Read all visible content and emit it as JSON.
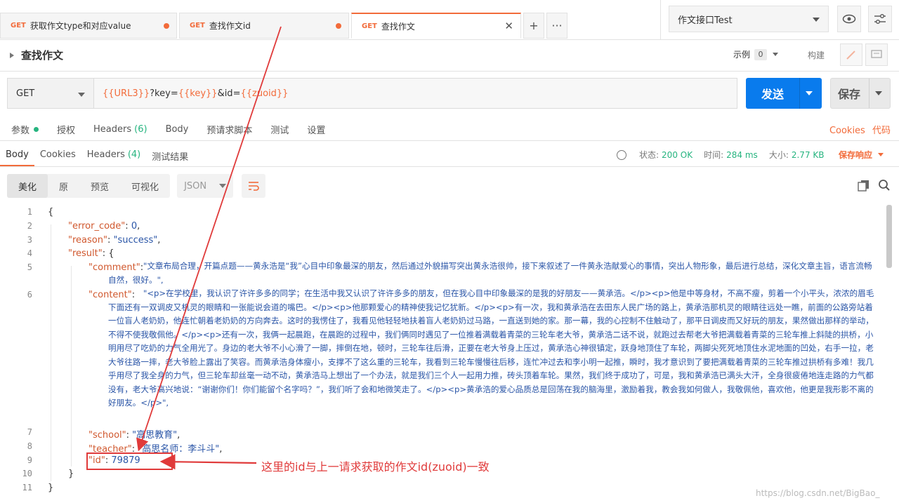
{
  "tabs": [
    {
      "method": "GET",
      "title": "获取作文type和对应value",
      "dirty": true
    },
    {
      "method": "GET",
      "title": "查找作文id",
      "dirty": true
    },
    {
      "method": "GET",
      "title": "查找作文",
      "active": true
    }
  ],
  "env": {
    "name": "作文接口Test"
  },
  "request": {
    "name": "查找作文",
    "examples_label": "示例",
    "examples_count": "0",
    "build_label": "构建",
    "method": "GET",
    "url": {
      "v1": "{{URL3}}",
      "t1": "?key=",
      "v2": "{{key}}",
      "t2": "&id=",
      "v3": "{{zuoid}}"
    },
    "send": "发送",
    "save": "保存"
  },
  "req_tabs": {
    "params": "参数",
    "auth": "授权",
    "headers": "Headers",
    "headers_count": "(6)",
    "body": "Body",
    "prereq": "预请求脚本",
    "tests": "测试",
    "settings": "设置",
    "cookies": "Cookies",
    "code": "代码"
  },
  "resp_tabs": {
    "body": "Body",
    "cookies": "Cookies",
    "headers": "Headers",
    "headers_count": "(4)",
    "results": "测试结果"
  },
  "status": {
    "status_label": "状态:",
    "status_val": "200 OK",
    "time_label": "时间:",
    "time_val": "284 ms",
    "size_label": "大小:",
    "size_val": "2.77 KB",
    "save_resp": "保存响应"
  },
  "format": {
    "pretty": "美化",
    "raw": "原",
    "preview": "预览",
    "visualize": "可视化",
    "lang": "JSON"
  },
  "code": {
    "l1": "{",
    "k_error": "\"error_code\"",
    "v_error": "0",
    "k_reason": "\"reason\"",
    "v_reason": "\"success\"",
    "k_result": "\"result\"",
    "k_comment": "\"comment\"",
    "v_comment": "\"文章布局合理，开篇点题——黄永浩是“我”心目中印象最深的朋友，然后通过外貌描写突出黄永浩很帅，接下来叙述了一件黄永浩献爱心的事情，突出人物形象，最后进行总结，深化文章主旨，语言流畅自然，很好。\",",
    "k_content": "\"content\"",
    "v_content": "\"<p>在学校里，我认识了许许多多的同学；在生活中我又认识了许许多多的朋友，但在我心目中印象最深的是我的好朋友——黄承浩。</p><p>他是中等身材，不高不瘦，剪着一个小平头，浓浓的眉毛下面还有一双调皮又机灵的眼睛和一张能说会道的嘴巴。</p><p>他那颗爱心的精神使我记忆犹新。</p><p>有一次，我和黄承浩在去田东人民广场的路上，黄承浩那机灵的眼睛往远处一瞧，前面的公路旁站着一位盲人老奶奶，他连忙朝着老奶奶的方向奔去。这时的我愣住了，我看见他轻轻地扶着盲人老奶奶过马路，一直送到她的家。那一幕，我的心控制不住触动了，那平日调皮而又好玩的朋友，果然做出那样的举动，不得不使我敬佩他。</p><p>还有一次，我俩一起晨跑，在晨跑的过程中，我们俩同时遇见了一位推着满载着青菜的三轮车老大爷，黄承浩二话不说，就跑过去帮老大爷把满载着青菜的三轮车推上斜陡的拱桥，小明用尽了吃奶的力气全用光了。身边的老大爷不小心滑了一脚，摔倒在地，顿时，三轮车往后滑，正要在老大爷身上压过，黄承浩心神很镇定，跃身地顶住了车轮，两脚尖死死地顶住水泥地面的凹处，右手一拉，老大爷往路一摔，老大爷脸上露出了笑容。而黄承浩身体瘦小，支撑不了这么重的三轮车，我看到三轮车慢慢往后移，连忙冲过去和李小明一起推，瞬时，我才意识到了要把满载着青菜的三轮车推过拱桥有多难！我几乎用尽了我全身的力气，但三轮车却丝毫一动不动，黄承浩马上想出了一个办法，就是我们三个人一起用力推，砖头顶着车轮。果然，我们终于成功了，可是，我和黄承浩已满头大汗，全身很疲倦地连走路的力气都没有，老大爷高兴地说：“谢谢你们！你们能留个名字吗？”，我们听了会和地微笑走了。</p><p>黄承浩的爱心品质总是回荡在我的脑海里，激励着我，教会我如何做人，我敬佩他，喜欢他，他更是我形影不离的好朋友。</p>\",",
    "k_school": "\"school\"",
    "v_school": "\"高思教育\"",
    "k_teacher": "\"teacher\"",
    "v_teacher": "\"高思名师：李斗斗\"",
    "k_id": "\"id\"",
    "v_id": "79879",
    "l10": "}",
    "l11": "}"
  },
  "annotation": "这里的id与上一请求获取的作文id(zuoid)一致",
  "watermark": "https://blog.csdn.net/BigBao_"
}
